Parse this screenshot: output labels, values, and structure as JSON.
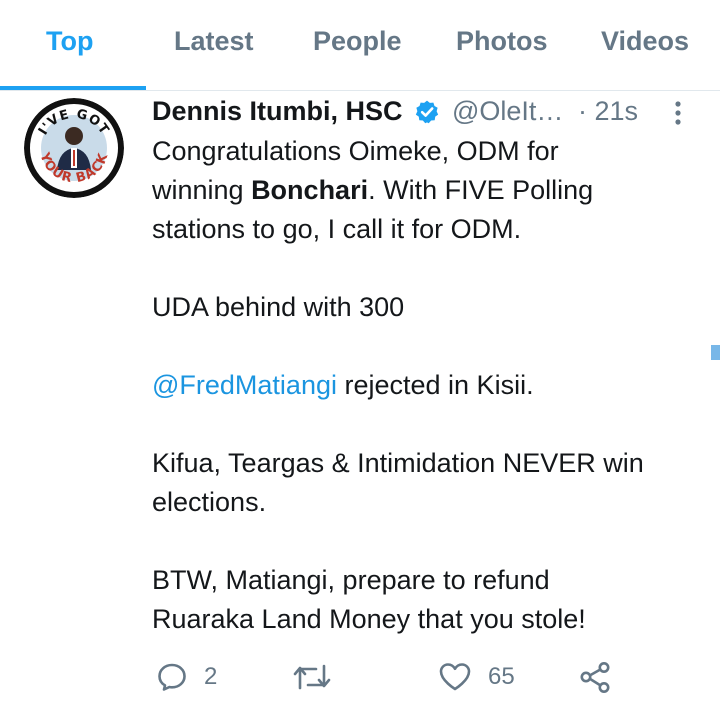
{
  "tabs": [
    {
      "label": "Top",
      "active": true
    },
    {
      "label": "Latest",
      "active": false
    },
    {
      "label": "People",
      "active": false
    },
    {
      "label": "Photos",
      "active": false
    },
    {
      "label": "Videos",
      "active": false
    }
  ],
  "tweet": {
    "author_name": "Dennis Itumbi, HSC",
    "handle": "@OleIt…",
    "time": "· 21s",
    "avatar_text_top": "I'VE GOT",
    "avatar_text_bottom": "YOUR BACK",
    "body": {
      "line1": "Congratulations Oimeke, ODM for",
      "line2_pre": "winning ",
      "line2_bold": "Bonchari",
      "line2_post": ". With FIVE Polling",
      "line3": "stations to go, I call it for ODM.",
      "line4": "UDA behind with 300",
      "mention": "@FredMatiangi",
      "line5_post": " rejected in Kisii.",
      "line6": "Kifua, Teargas & Intimidation NEVER win",
      "line7": "elections.",
      "line8": "BTW, Matiangi, prepare to refund",
      "line9": "Ruaraka Land Money that you stole!"
    },
    "actions": {
      "reply_count": "2",
      "retweet_count": "",
      "like_count": "65"
    }
  },
  "colors": {
    "accent": "#1da1f2",
    "mention": "#1b95e0",
    "secondary_text": "#657786",
    "primary_text": "#14171a"
  },
  "icons": [
    "verified-badge-icon",
    "more-vertical-icon",
    "reply-icon",
    "retweet-icon",
    "like-icon",
    "share-icon"
  ]
}
